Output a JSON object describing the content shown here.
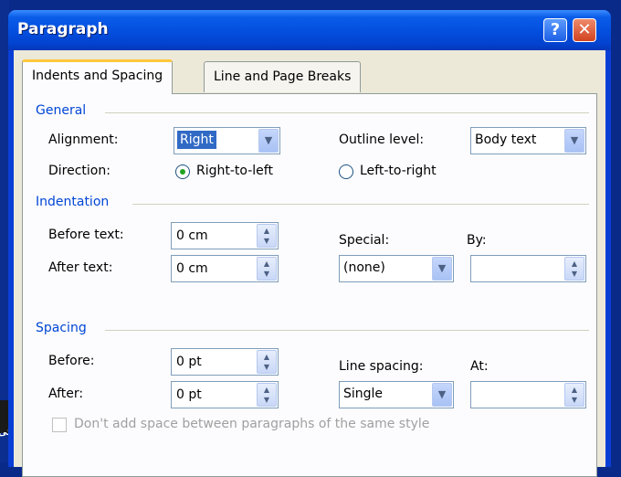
{
  "window": {
    "title": "Paragraph"
  },
  "titlebar": {
    "help_glyph": "?",
    "close_glyph": "✕"
  },
  "tabs": [
    {
      "label": "Indents and Spacing",
      "active": true
    },
    {
      "label": "Line and Page Breaks",
      "active": false
    }
  ],
  "general": {
    "title": "General",
    "alignment_label": "Alignment:",
    "alignment_value": "Right",
    "outline_label": "Outline level:",
    "outline_value": "Body text",
    "direction_label": "Direction:",
    "rtl_label": "Right-to-left",
    "ltr_label": "Left-to-right",
    "direction_selected": "Right-to-left"
  },
  "indentation": {
    "title": "Indentation",
    "before_label": "Before text:",
    "before_value": "0 cm",
    "after_label": "After text:",
    "after_value": "0 cm",
    "special_label": "Special:",
    "special_value": "(none)",
    "by_label": "By:",
    "by_value": ""
  },
  "spacing": {
    "title": "Spacing",
    "before_label": "Before:",
    "before_value": "0 pt",
    "after_label": "After:",
    "after_value": "0 pt",
    "line_spacing_label": "Line spacing:",
    "line_spacing_value": "Single",
    "at_label": "At:",
    "at_value": "",
    "no_space_label": "Don't add space between paragraphs of the same style",
    "no_space_checked": false
  },
  "background": {
    "partial_text": "کی"
  },
  "colors": {
    "title_bar": "#0450e0",
    "client_bg": "#ece9d8",
    "group_title": "#0046d5",
    "selection": "#316ac5",
    "active_tab_highlight": "#ffc83c"
  }
}
